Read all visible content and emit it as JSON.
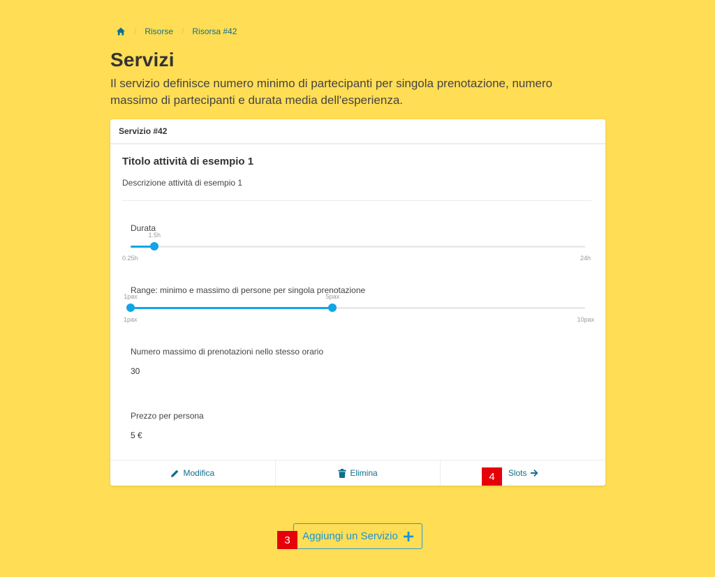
{
  "breadcrumb": {
    "home_icon": "home-icon",
    "items": [
      "Risorse",
      "Risorsa #42"
    ]
  },
  "page": {
    "title": "Servizi",
    "description": "Il servizio definisce numero minimo di partecipanti per singola prenotazione, numero massimo di partecipanti e durata media dell'esperienza."
  },
  "card": {
    "header": "Servizio #42",
    "activity_title": "Titolo attività di esempio 1",
    "activity_description": "Descrizione attività di esempio 1",
    "durata": {
      "label": "Durata",
      "value_label": "1.5h",
      "value": 1.5,
      "min_label": "0.25h",
      "max_label": "24h",
      "min": 0.25,
      "max": 24
    },
    "range": {
      "label": "Range: minimo e massimo di persone per singola prenotazione",
      "low_label": "1pax",
      "high_label": "5pax",
      "low": 1,
      "high": 5,
      "min_label": "1pax",
      "max_label": "10pax",
      "min": 1,
      "max": 10
    },
    "max_bookings": {
      "label": "Numero massimo di prenotazioni nello stesso orario",
      "value": "30"
    },
    "price": {
      "label": "Prezzo per persona",
      "value": "5 €"
    },
    "footer": {
      "edit_label": "Modifica",
      "delete_label": "Elimina",
      "slots_label": "Slots"
    }
  },
  "add_button_label": "Aggiungi un Servizio",
  "badges": {
    "slots": "4",
    "add": "3"
  },
  "colors": {
    "background": "#ffdd55",
    "accent": "#11a5e6",
    "link": "#0f6f8c",
    "badge": "#e6000a"
  }
}
